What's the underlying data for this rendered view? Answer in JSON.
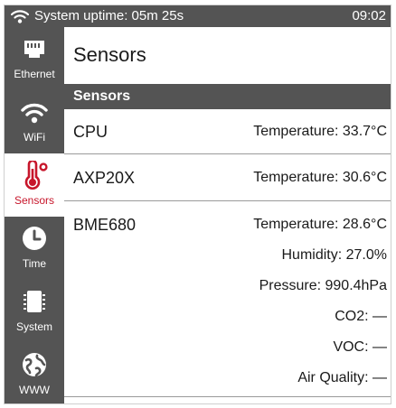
{
  "status_bar": {
    "uptime": "System uptime: 05m 25s",
    "time": "09:02",
    "wifi_icon": "wifi-icon"
  },
  "sidebar": {
    "items": [
      {
        "label": "Ethernet",
        "icon": "ethernet-icon",
        "active": false
      },
      {
        "label": "WiFi",
        "icon": "wifi-icon",
        "active": false
      },
      {
        "label": "Sensors",
        "icon": "thermometer-icon",
        "active": true
      },
      {
        "label": "Time",
        "icon": "clock-icon",
        "active": false
      },
      {
        "label": "System",
        "icon": "chip-icon",
        "active": false
      },
      {
        "label": "WWW",
        "icon": "globe-icon",
        "active": false
      }
    ]
  },
  "main": {
    "title": "Sensors",
    "section_header": "Sensors",
    "sensors": [
      {
        "name": "CPU",
        "readings": [
          "Temperature: 33.7°C"
        ]
      },
      {
        "name": "AXP20X",
        "readings": [
          "Temperature: 30.6°C"
        ]
      },
      {
        "name": "BME680",
        "readings": [
          "Temperature: 28.6°C",
          "Humidity: 27.0%",
          "Pressure: 990.4hPa",
          "CO2: —",
          "VOC: —",
          "Air Quality: —"
        ]
      }
    ]
  },
  "colors": {
    "bar": "#545454",
    "accent": "#c7162b",
    "text": "#1a1a1a"
  }
}
